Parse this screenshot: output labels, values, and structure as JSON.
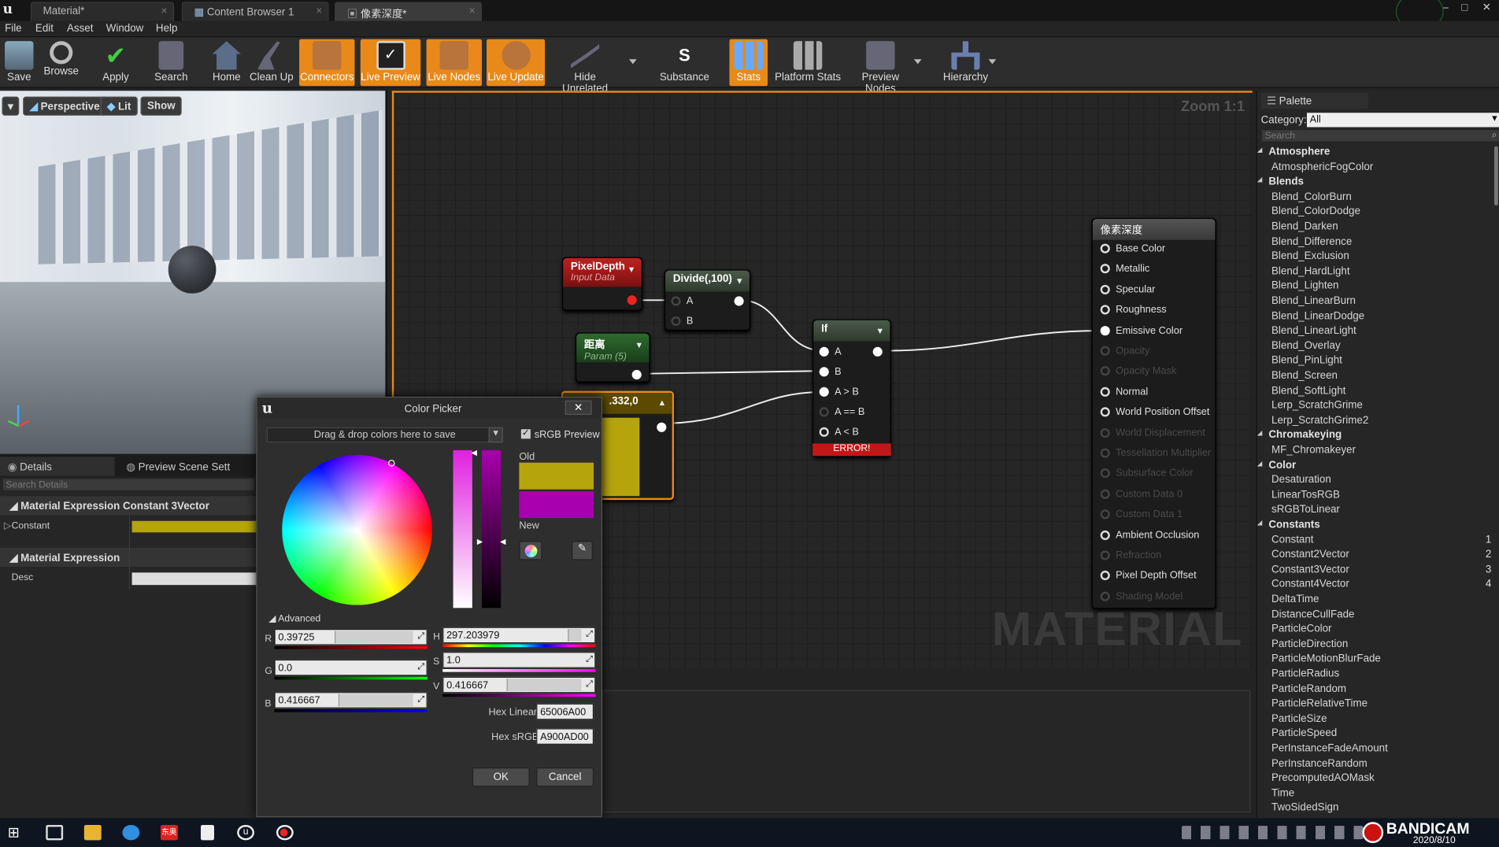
{
  "tabs": [
    {
      "label": "Material*"
    },
    {
      "label": "Content Browser 1"
    },
    {
      "label": "像素深度*"
    }
  ],
  "menu": [
    "File",
    "Edit",
    "Asset",
    "Window",
    "Help"
  ],
  "toolbar": {
    "save": "Save",
    "browse": "Browse",
    "apply": "Apply",
    "search": "Search",
    "home": "Home",
    "cleanup": "Clean Up",
    "connectors": "Connectors",
    "live_preview": "Live Preview",
    "live_nodes": "Live Nodes",
    "live_update": "Live Update",
    "hide_unrelated": "Hide Unrelated",
    "substance": "Substance",
    "stats": "Stats",
    "platform_stats": "Platform Stats",
    "preview_nodes": "Preview Nodes",
    "hierarchy": "Hierarchy"
  },
  "viewport": {
    "perspective": "Perspective",
    "lit": "Lit",
    "show": "Show"
  },
  "details": {
    "tab_details": "Details",
    "tab_preview": "Preview Scene Sett",
    "search_placeholder": "Search Details",
    "section1": "Material Expression Constant 3Vector",
    "constant_label": "Constant",
    "section2": "Material Expression",
    "desc_label": "Desc"
  },
  "graph": {
    "zoom": "Zoom 1:1",
    "watermark": "MATERIAL",
    "pixeldepth": {
      "title": "PixelDepth",
      "subtitle": "Input Data"
    },
    "divide": {
      "title": "Divide(,100)",
      "a": "A",
      "b": "B"
    },
    "param": {
      "title": "距离",
      "subtitle": "Param (5)"
    },
    "vector": {
      "title": ".332,0"
    },
    "if_node": {
      "title": "If",
      "a": "A",
      "b": "B",
      "agb": "A > B",
      "aeb": "A == B",
      "alb": "A < B",
      "error": "ERROR!"
    },
    "result": {
      "title": "像素深度",
      "pins": [
        {
          "label": "Base Color",
          "enabled": true
        },
        {
          "label": "Metallic",
          "enabled": true
        },
        {
          "label": "Specular",
          "enabled": true
        },
        {
          "label": "Roughness",
          "enabled": true
        },
        {
          "label": "Emissive Color",
          "enabled": true,
          "connected": true
        },
        {
          "label": "Opacity",
          "enabled": false
        },
        {
          "label": "Opacity Mask",
          "enabled": false
        },
        {
          "label": "Normal",
          "enabled": true
        },
        {
          "label": "World Position Offset",
          "enabled": true
        },
        {
          "label": "World Displacement",
          "enabled": false
        },
        {
          "label": "Tessellation Multiplier",
          "enabled": false
        },
        {
          "label": "Subsurface Color",
          "enabled": false
        },
        {
          "label": "Custom Data 0",
          "enabled": false
        },
        {
          "label": "Custom Data 1",
          "enabled": false
        },
        {
          "label": "Ambient Occlusion",
          "enabled": true
        },
        {
          "label": "Refraction",
          "enabled": false
        },
        {
          "label": "Pixel Depth Offset",
          "enabled": true
        },
        {
          "label": "Shading Model",
          "enabled": false
        }
      ]
    }
  },
  "palette": {
    "title": "Palette",
    "category_label": "Category:",
    "category_value": "All",
    "search_placeholder": "Search",
    "items": [
      {
        "label": "Atmosphere",
        "cat": true
      },
      {
        "label": "AtmosphericFogColor"
      },
      {
        "label": "Blends",
        "cat": true
      },
      {
        "label": "Blend_ColorBurn"
      },
      {
        "label": "Blend_ColorDodge"
      },
      {
        "label": "Blend_Darken"
      },
      {
        "label": "Blend_Difference"
      },
      {
        "label": "Blend_Exclusion"
      },
      {
        "label": "Blend_HardLight"
      },
      {
        "label": "Blend_Lighten"
      },
      {
        "label": "Blend_LinearBurn"
      },
      {
        "label": "Blend_LinearDodge"
      },
      {
        "label": "Blend_LinearLight"
      },
      {
        "label": "Blend_Overlay"
      },
      {
        "label": "Blend_PinLight"
      },
      {
        "label": "Blend_Screen"
      },
      {
        "label": "Blend_SoftLight"
      },
      {
        "label": "Lerp_ScratchGrime"
      },
      {
        "label": "Lerp_ScratchGrime2"
      },
      {
        "label": "Chromakeying",
        "cat": true
      },
      {
        "label": "MF_Chromakeyer"
      },
      {
        "label": "Color",
        "cat": true
      },
      {
        "label": "Desaturation"
      },
      {
        "label": "LinearTosRGB"
      },
      {
        "label": "sRGBToLinear"
      },
      {
        "label": "Constants",
        "cat": true
      },
      {
        "label": "Constant",
        "num": "1"
      },
      {
        "label": "Constant2Vector",
        "num": "2"
      },
      {
        "label": "Constant3Vector",
        "num": "3"
      },
      {
        "label": "Constant4Vector",
        "num": "4"
      },
      {
        "label": "DeltaTime"
      },
      {
        "label": "DistanceCullFade"
      },
      {
        "label": "ParticleColor"
      },
      {
        "label": "ParticleDirection"
      },
      {
        "label": "ParticleMotionBlurFade"
      },
      {
        "label": "ParticleRadius"
      },
      {
        "label": "ParticleRandom"
      },
      {
        "label": "ParticleRelativeTime"
      },
      {
        "label": "ParticleSize"
      },
      {
        "label": "ParticleSpeed"
      },
      {
        "label": "PerInstanceFadeAmount"
      },
      {
        "label": "PerInstanceRandom"
      },
      {
        "label": "PrecomputedAOMask"
      },
      {
        "label": "Time"
      },
      {
        "label": "TwoSidedSign"
      }
    ]
  },
  "picker": {
    "title": "Color Picker",
    "drag_text": "Drag & drop colors here to save",
    "srgb": "sRGB Preview",
    "old": "Old",
    "new": "New",
    "advanced": "Advanced",
    "r_label": "R",
    "r": "0.39725",
    "g_label": "G",
    "g": "0.0",
    "b_label": "B",
    "b": "0.416667",
    "h_label": "H",
    "h": "297.203979",
    "s_label": "S",
    "s": "1.0",
    "v_label": "V",
    "v": "0.416667",
    "hex_linear_label": "Hex Linear",
    "hex_linear": "65006A00",
    "hex_srgb_label": "Hex sRGB",
    "hex_srgb": "A900AD00",
    "ok": "OK",
    "cancel": "Cancel",
    "old_color": "#b5a40c",
    "new_color": "#a900ad"
  },
  "taskbar": {
    "app_tag": "东奥",
    "bandicam": "BANDICAM",
    "date": "2020/8/10"
  },
  "colors": {
    "accent": "#e8891a",
    "constant_color": "#b5a40c"
  }
}
